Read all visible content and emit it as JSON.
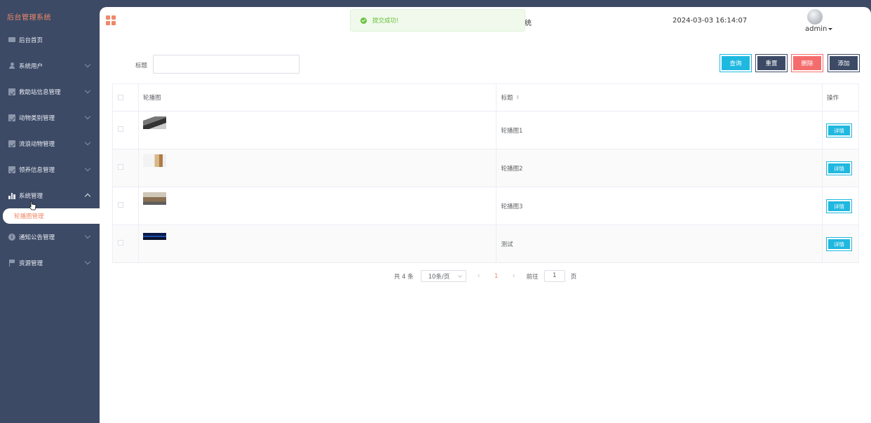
{
  "sidebar": {
    "brand": "后台管理系统",
    "items": [
      {
        "label": "后台首页",
        "icon": "monitor-icon"
      },
      {
        "label": "系统用户",
        "icon": "user-icon"
      },
      {
        "label": "救助站信息管理",
        "icon": "checkbox-icon"
      },
      {
        "label": "动物类别管理",
        "icon": "checkbox-icon"
      },
      {
        "label": "流浪动物管理",
        "icon": "checkbox-icon"
      },
      {
        "label": "领养信息管理",
        "icon": "checkbox-icon"
      },
      {
        "label": "系统管理",
        "icon": "bar-chart-icon",
        "expanded": true
      },
      {
        "label": "通知公告管理",
        "icon": "info-icon"
      },
      {
        "label": "资源管理",
        "icon": "flag-icon"
      }
    ],
    "active_sub": "轮播图管理"
  },
  "header": {
    "title_fragment": "统",
    "datetime": "2024-03-03 16:14:07",
    "user": "admin"
  },
  "toast": {
    "message": "提交成功!",
    "type": "success"
  },
  "search": {
    "label": "标题",
    "value": ""
  },
  "buttons": {
    "query": "查询",
    "reset": "重置",
    "delete": "删除",
    "add": "添加"
  },
  "table": {
    "headers": {
      "image": "轮播图",
      "title": "标题",
      "action": "操作"
    },
    "rows": [
      {
        "title": "轮播图1",
        "action": "详情"
      },
      {
        "title": "轮播图2",
        "action": "详情"
      },
      {
        "title": "轮播图3",
        "action": "详情"
      },
      {
        "title": "测试",
        "action": "详情"
      }
    ]
  },
  "pagination": {
    "total": "共 4 条",
    "page_size": "10条/页",
    "current_page": "1",
    "goto_label": "前往",
    "goto_value": "1",
    "page_suffix": "页"
  },
  "colors": {
    "sidebar_bg": "#3c4a66",
    "accent": "#f08969",
    "primary": "#1fb8e0",
    "danger": "#f56c6c",
    "success": "#67c23a"
  }
}
